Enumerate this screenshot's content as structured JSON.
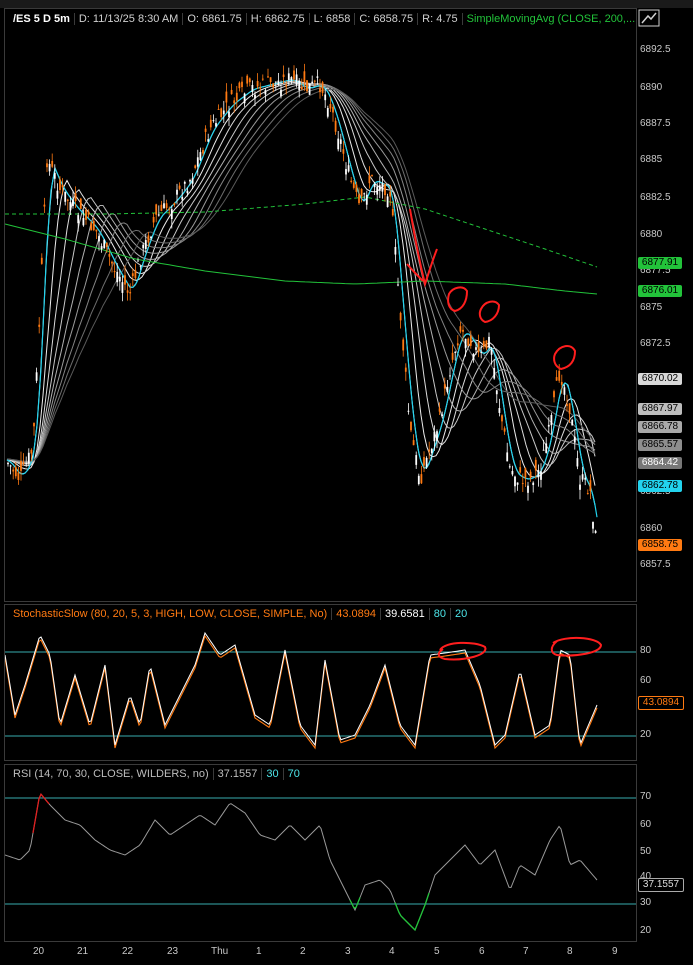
{
  "main": {
    "symbol": "/ES 5 D 5m",
    "date": "D: 11/13/25 8:30 AM",
    "open": "O: 6861.75",
    "high": "H: 6862.75",
    "low": "L: 6858",
    "close": "C: 6858.75",
    "range": "R: 4.75",
    "study": "SimpleMovingAvg (CLOSE, 200,...",
    "y_ticks": [
      "6892.5",
      "6890",
      "6887.5",
      "6885",
      "6882.5",
      "6880",
      "6877.5",
      "6875",
      "6872.5",
      "6862.5",
      "6860",
      "6857.5"
    ],
    "price_tags": {
      "sma_short": {
        "value": "6877.91",
        "color": "#22c33a"
      },
      "sma_long": {
        "value": "6876.01",
        "color": "#22c33a"
      },
      "ribbon1": {
        "value": "6870.02",
        "color": "#b0b0b0"
      },
      "ribbon2": {
        "value": "6867.97",
        "color": "#b0b0b0"
      },
      "ribbon3": {
        "value": "6866.78",
        "color": "#b0b0b0"
      },
      "ribbon4": {
        "value": "6865.57",
        "color": "#b0b0b0"
      },
      "ribbon5": {
        "value": "6864.42",
        "color": "#b0b0b0"
      },
      "ema_fast": {
        "value": "6862.78",
        "color": "#22d3ee"
      },
      "last": {
        "value": "6858.75",
        "color": "#ff7a12"
      }
    }
  },
  "stoch": {
    "title": "StochasticSlow (80, 20, 5, 3, HIGH, LOW, CLOSE, SIMPLE, No)",
    "k": "43.0894",
    "d": "39.6581",
    "ob": "80",
    "os": "20",
    "y_ticks": [
      "80",
      "60",
      "20"
    ],
    "tag": "43.0894"
  },
  "rsi": {
    "title": "RSI (14, 70, 30, CLOSE, WILDERS, no)",
    "value": "37.1557",
    "os": "30",
    "ob": "70",
    "y_ticks": [
      "70",
      "60",
      "50",
      "40",
      "30",
      "20"
    ],
    "tag": "37.1557"
  },
  "x_axis": [
    "20",
    "21",
    "22",
    "23",
    "Thu",
    "1",
    "2",
    "3",
    "4",
    "5",
    "6",
    "7",
    "8",
    "9"
  ]
}
